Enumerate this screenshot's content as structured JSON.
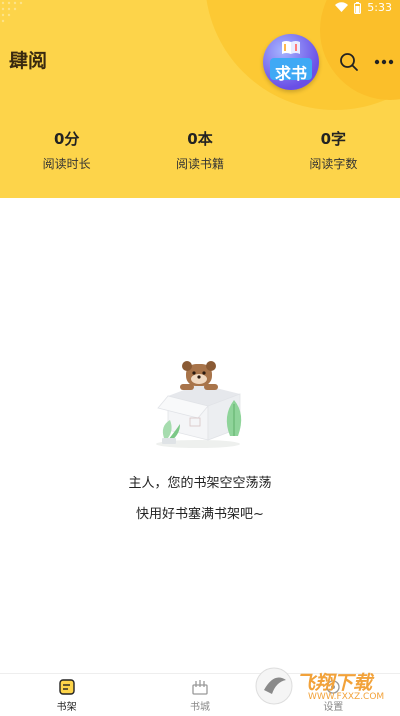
{
  "status_bar": {
    "time": "5:33"
  },
  "header": {
    "app_title": "肆阅",
    "request_book_label": "求书",
    "stats": [
      {
        "value": "0分",
        "label": "阅读时长"
      },
      {
        "value": "0本",
        "label": "阅读书籍"
      },
      {
        "value": "0字",
        "label": "阅读字数"
      }
    ]
  },
  "empty_state": {
    "line1": "主人，您的书架空空荡荡",
    "line2": "快用好书塞满书架吧~"
  },
  "bottom_nav": {
    "items": [
      {
        "label": "书架",
        "icon": "bookshelf-icon",
        "active": true
      },
      {
        "label": "书城",
        "icon": "bookstore-icon",
        "active": false
      },
      {
        "label": "设置",
        "icon": "settings-icon",
        "active": false
      }
    ]
  },
  "watermark": {
    "text": "飞翔下载",
    "url": "WWW.FXXZ.COM"
  },
  "colors": {
    "header_bg": "#fdd44a",
    "accent": "#fbbf2a"
  }
}
